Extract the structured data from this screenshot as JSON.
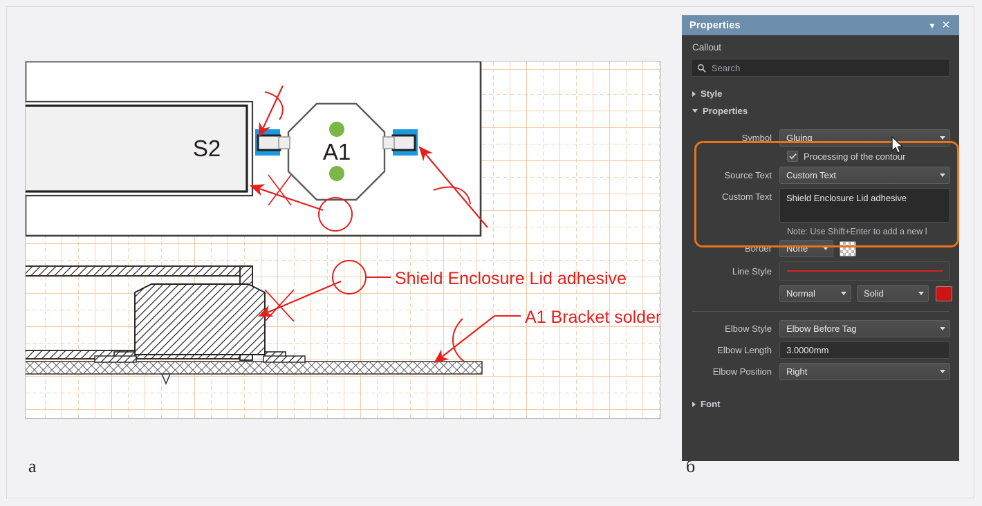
{
  "figure": {
    "caption_left": "а",
    "caption_right": "б"
  },
  "cad": {
    "labels": {
      "s2": "S2",
      "a1": "A1",
      "callout_adhesive": "Shield Enclosure Lid adhesive",
      "callout_solder": "A1 Bracket solder"
    },
    "colors": {
      "annotation_red": "#e3201d",
      "grid_orange": "#f5c9a0",
      "selection_blue": "#1b9ae0",
      "pad_green": "#7ab648",
      "outline_black": "#231f20"
    }
  },
  "panel": {
    "title": "Properties",
    "title_buttons": {
      "menu": "▾",
      "close": "✕"
    },
    "object_name": "Callout",
    "search": {
      "placeholder": "Search",
      "icon": "search-icon"
    },
    "sections": [
      {
        "label": "Style",
        "expanded": false
      },
      {
        "label": "Properties",
        "expanded": true
      },
      {
        "label": "Font",
        "expanded": false
      }
    ],
    "properties": {
      "symbol": {
        "label": "Symbol",
        "value": "Gluing"
      },
      "processing_contour": {
        "label": "Processing of the contour",
        "checked": true
      },
      "source_text": {
        "label": "Source Text",
        "value": "Custom Text"
      },
      "custom_text": {
        "label": "Custom Text",
        "value": "Shield Enclosure Lid adhesive"
      },
      "note": "Note: Use Shift+Enter to add a new l",
      "border": {
        "label": "Border",
        "value": "None",
        "swatch": "transparent-checker"
      },
      "line_style": {
        "label": "Line Style",
        "preview_color": "#d62020"
      },
      "line_weight": {
        "value": "Normal"
      },
      "line_pattern": {
        "value": "Solid"
      },
      "line_color": {
        "value": "#cc1414"
      },
      "elbow_style": {
        "label": "Elbow Style",
        "value": "Elbow Before Tag"
      },
      "elbow_length": {
        "label": "Elbow Length",
        "value": "3.0000mm"
      },
      "elbow_position": {
        "label": "Elbow Position",
        "value": "Right"
      }
    },
    "colors": {
      "titlebar": "#6e8fab",
      "background": "#3b3b3b",
      "highlight_border": "#e8731a",
      "accent_red": "#cc1414"
    }
  }
}
